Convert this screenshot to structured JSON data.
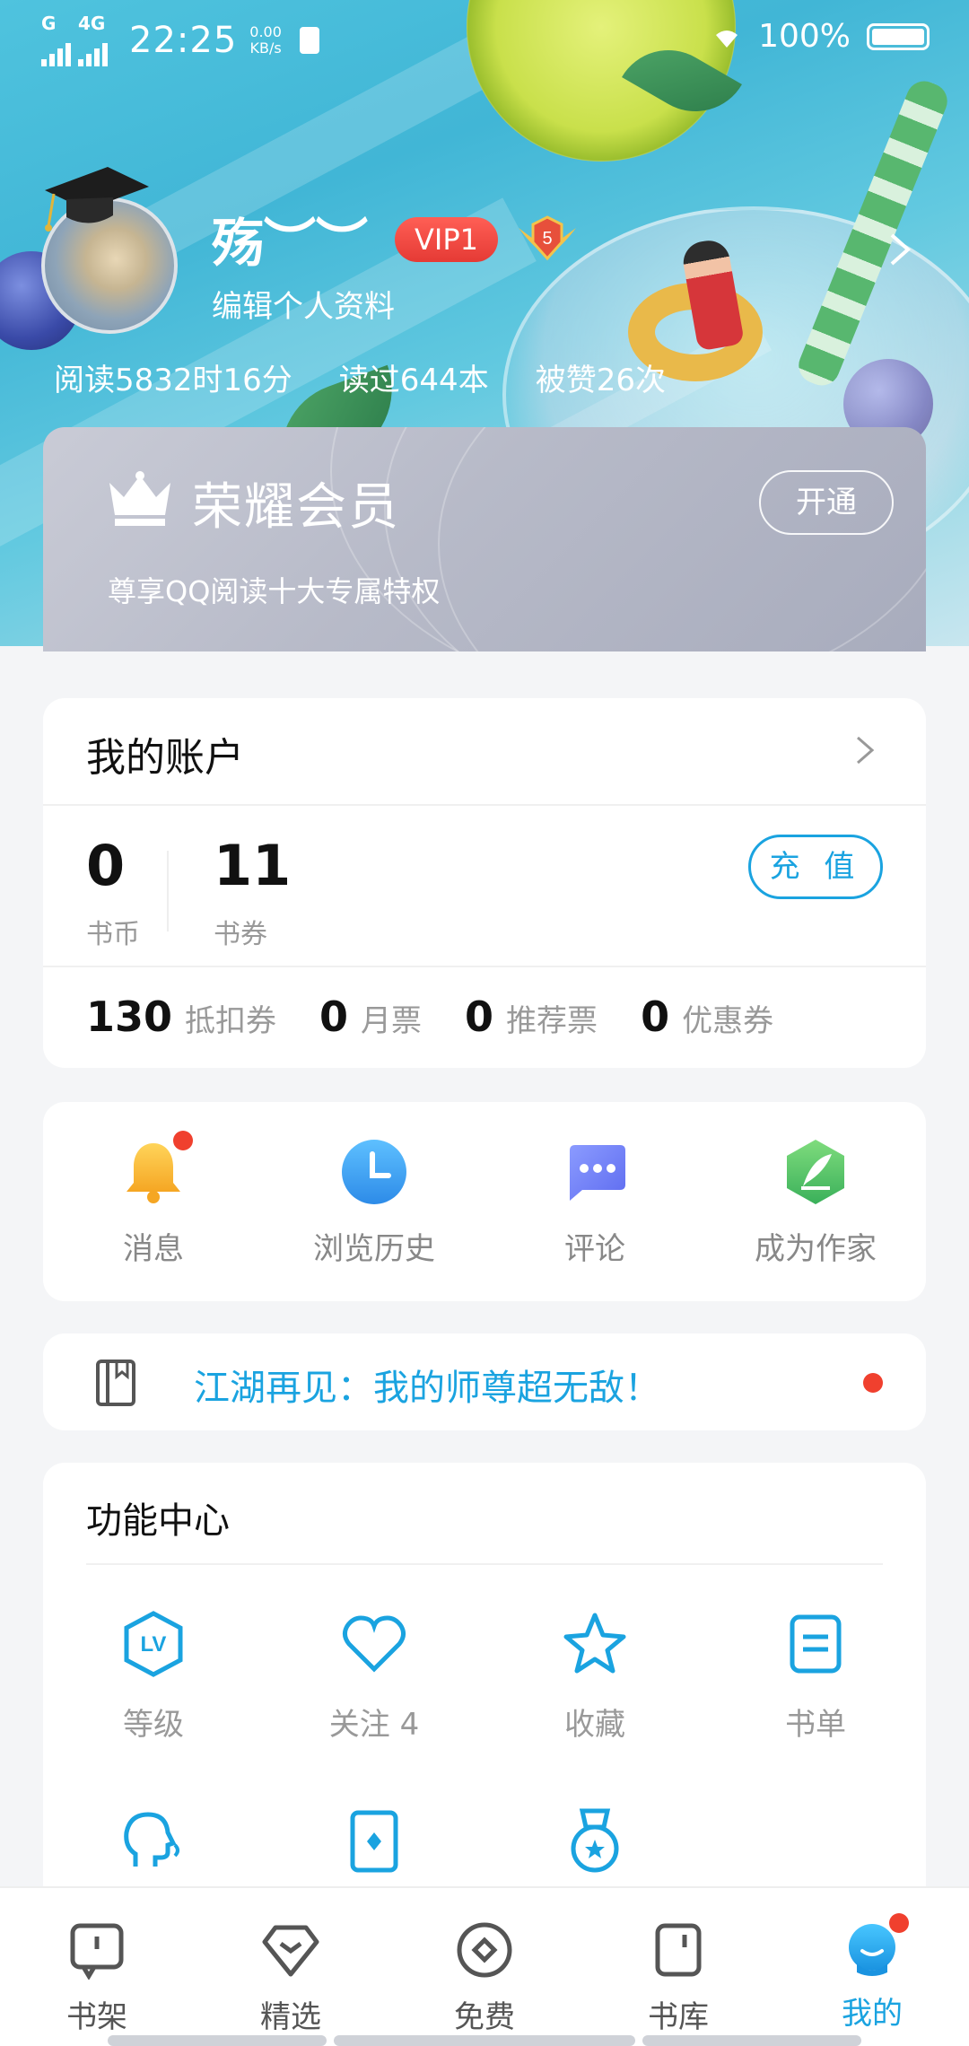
{
  "status_bar": {
    "network_1": "G",
    "network_2": "4G",
    "time": "22:25",
    "speed_value": "0.00",
    "speed_unit": "KB/s",
    "battery_percent": "100%"
  },
  "header_icons": [
    "chat-icon",
    "moon-icon",
    "settings-hexagon-icon"
  ],
  "profile": {
    "username": "殇︶︶",
    "vip_label": "VIP1",
    "level_number": "5",
    "edit_label": "编辑个人资料",
    "stats": [
      "阅读5832时16分",
      "读过644本",
      "被赞26次"
    ]
  },
  "membership": {
    "title": "荣耀会员",
    "button_label": "开通",
    "description": "尊享QQ阅读十大专属特权"
  },
  "account": {
    "title": "我的账户",
    "balances": [
      {
        "value": "0",
        "label": "书币"
      },
      {
        "value": "11",
        "label": "书券"
      }
    ],
    "recharge_label": "充 值",
    "tickets": [
      {
        "value": "130",
        "label": "抵扣券"
      },
      {
        "value": "0",
        "label": "月票"
      },
      {
        "value": "0",
        "label": "推荐票"
      },
      {
        "value": "0",
        "label": "优惠券"
      }
    ]
  },
  "quick_actions": [
    {
      "label": "消息",
      "icon": "bell-icon",
      "color": "#f7b32b"
    },
    {
      "label": "浏览历史",
      "icon": "clock-icon",
      "color": "#3aa0ef"
    },
    {
      "label": "评论",
      "icon": "comment-icon",
      "color": "#6a7ff2"
    },
    {
      "label": "成为作家",
      "icon": "quill-icon",
      "color": "#52c567"
    }
  ],
  "notice": {
    "text": "江湖再见：我的师尊超无敌！"
  },
  "function_center": {
    "title": "功能中心",
    "items": [
      {
        "label": "等级",
        "icon": "level-icon"
      },
      {
        "label": "关注 4",
        "icon": "heart-icon"
      },
      {
        "label": "收藏",
        "icon": "star-icon"
      },
      {
        "label": "书单",
        "icon": "booklist-icon"
      },
      {
        "label": "",
        "icon": "voice-icon"
      },
      {
        "label": "",
        "icon": "card-icon"
      },
      {
        "label": "",
        "icon": "medal-icon"
      }
    ]
  },
  "bottom_nav": [
    {
      "label": "书架",
      "icon": "bookshelf-icon"
    },
    {
      "label": "精选",
      "icon": "diamond-icon"
    },
    {
      "label": "免费",
      "icon": "free-icon"
    },
    {
      "label": "书库",
      "icon": "library-icon"
    },
    {
      "label": "我的",
      "icon": "me-icon",
      "active": true
    }
  ],
  "colors": {
    "accent": "#1aa3e0",
    "badge_red": "#f0402e",
    "vip_red": "#e53a35"
  }
}
